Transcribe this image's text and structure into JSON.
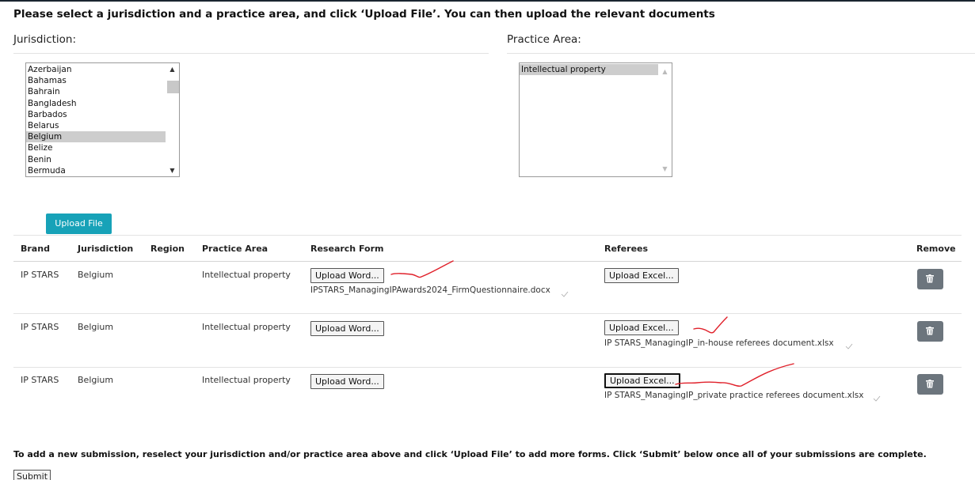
{
  "instructions": "Please select a jurisdiction and a practice area, and click ‘Upload File’. You can then upload the relevant documents",
  "jurisdiction": {
    "label": "Jurisdiction:",
    "options": [
      "Azerbaijan",
      "Bahamas",
      "Bahrain",
      "Bangladesh",
      "Barbados",
      "Belarus",
      "Belgium",
      "Belize",
      "Benin",
      "Bermuda"
    ],
    "selected": "Belgium"
  },
  "practice_area": {
    "label": "Practice Area:",
    "options": [
      "Intellectual property"
    ],
    "selected": "Intellectual property"
  },
  "upload_file_label": "Upload File",
  "table": {
    "headers": [
      "Brand",
      "Jurisdiction",
      "Region",
      "Practice Area",
      "Research Form",
      "Referees",
      "Remove"
    ],
    "rows": [
      {
        "brand": "IP STARS",
        "jurisdiction": "Belgium",
        "region": "",
        "practice_area": "Intellectual property",
        "research_button": "Upload Word...",
        "research_file": "IPSTARS_ManagingIPAwards2024_FirmQuestionnaire.docx",
        "referees_button": "Upload Excel...",
        "referees_file": ""
      },
      {
        "brand": "IP STARS",
        "jurisdiction": "Belgium",
        "region": "",
        "practice_area": "Intellectual property",
        "research_button": "Upload Word...",
        "research_file": "",
        "referees_button": "Upload Excel...",
        "referees_file": "IP STARS_ManagingIP_in-house referees document.xlsx"
      },
      {
        "brand": "IP STARS",
        "jurisdiction": "Belgium",
        "region": "",
        "practice_area": "Intellectual property",
        "research_button": "Upload Word...",
        "research_file": "",
        "referees_button": "Upload Excel...",
        "referees_file": "IP STARS_ManagingIP_private practice referees document.xlsx"
      }
    ]
  },
  "footer_text": "To add a new submission, reselect your jurisdiction and/or practice area above and click ‘Upload File’ to add more forms. Click ‘Submit’ below once all of your submissions are complete.",
  "submit_label": "Submit",
  "colors": {
    "upload_button": "#17a2b8",
    "remove_button": "#6c757d",
    "annotation_ink": "#e0202a"
  }
}
